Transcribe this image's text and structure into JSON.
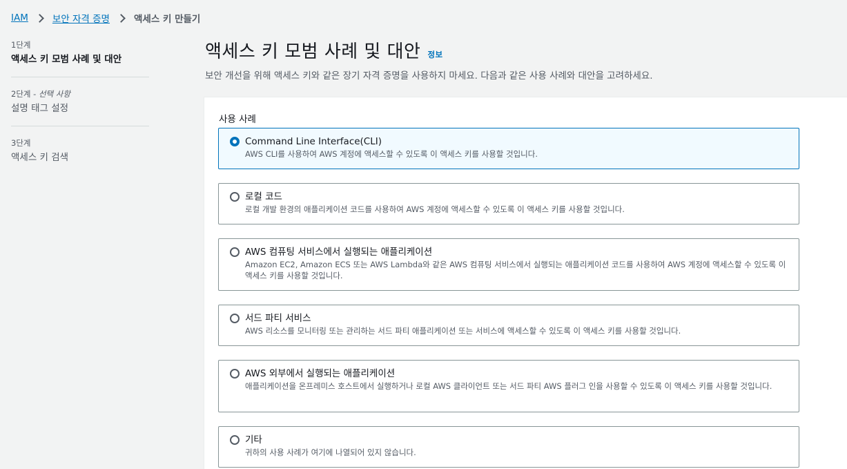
{
  "breadcrumb": {
    "items": [
      "IAM",
      "보안 자격 증명"
    ],
    "current": "액세스 키 만들기"
  },
  "steps": [
    {
      "num": "1단계",
      "optional": "",
      "title": "액세스 키 모범 사례 및 대안"
    },
    {
      "num": "2단계 - ",
      "optional": "선택 사항",
      "title": "설명 태그 설정"
    },
    {
      "num": "3단계",
      "optional": "",
      "title": "액세스 키 검색"
    }
  ],
  "header": {
    "title": "액세스 키 모범 사례 및 대안",
    "info": "정보",
    "description": "보안 개선을 위해 액세스 키와 같은 장기 자격 증명을 사용하지 마세요. 다음과 같은 사용 사례와 대안을 고려하세요."
  },
  "use_cases": {
    "label": "사용 사례",
    "selected_index": 0,
    "options": [
      {
        "title": "Command Line Interface(CLI)",
        "desc": "AWS CLI를 사용하여 AWS 계정에 액세스할 수 있도록 이 액세스 키를 사용할 것입니다."
      },
      {
        "title": "로컬 코드",
        "desc": "로컬 개발 환경의 애플리케이션 코드를 사용하여 AWS 계정에 액세스할 수 있도록 이 액세스 키를 사용할 것입니다."
      },
      {
        "title": "AWS 컴퓨팅 서비스에서 실행되는 애플리케이션",
        "desc": "Amazon EC2, Amazon ECS 또는 AWS Lambda와 같은 AWS 컴퓨팅 서비스에서 실행되는 애플리케이션 코드를 사용하여 AWS 계정에 액세스할 수 있도록 이 액세스 키를 사용할 것입니다."
      },
      {
        "title": "서드 파티 서비스",
        "desc": "AWS 리소스를 모니터링 또는 관리하는 서드 파티 애플리케이션 또는 서비스에 액세스할 수 있도록 이 액세스 키를 사용할 것입니다."
      },
      {
        "title": "AWS 외부에서 실행되는 애플리케이션",
        "desc": "애플리케이션을 온프레미스 호스트에서 실행하거나 로컬 AWS 클라이언트 또는 서드 파티 AWS 플러그 인을 사용할 수 있도록 이 액세스 키를 사용할 것입니다."
      },
      {
        "title": "기타",
        "desc": "귀하의 사용 사례가 여기에 나열되어 있지 않습니다."
      }
    ]
  }
}
